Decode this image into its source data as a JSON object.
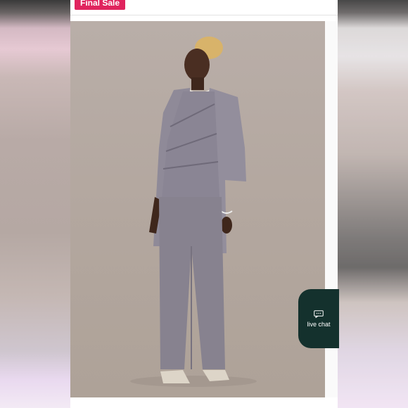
{
  "badge": {
    "label": "Final Sale"
  },
  "product_image": {
    "description_icon": "product-photo"
  },
  "live_chat": {
    "label": "live chat",
    "icon": "chat-bubble-icon"
  },
  "colors": {
    "badge": "#e0245e",
    "live_chat_bg": "#14312d",
    "outfit": "#8c8895",
    "backdrop": "#b3a79f"
  }
}
